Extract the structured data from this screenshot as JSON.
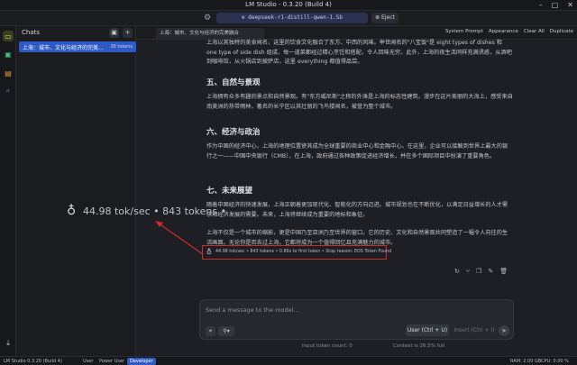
{
  "window": {
    "title": "LM Studio - 0.3.20 (Build 4)",
    "min": "–",
    "max": "□",
    "close": "✕"
  },
  "topbar": {
    "model": "⊕  deepseek-r1-distill-qwen-1.5b",
    "eject": "⊗ Eject"
  },
  "chats": {
    "title": "Chats",
    "items": [
      {
        "title": "上海：城市、文化与经济的完美…",
        "tokens": "36 tokens"
      }
    ]
  },
  "tab": {
    "title": "上海：城市、文化与经济的完美融合"
  },
  "toolbar": {
    "system_prompt": "System Prompt",
    "appearance": "Appearance",
    "clear_all": "Clear All",
    "duplicate": "Duplicate"
  },
  "content": {
    "p1": "上海以其独特的美食闻名，这里的饮食文化融合了东方、中西的风味。举世闻名的\"八宝饭\"是 eight types of dishes 和 one type of side dish 组成，每一道菜都经过精心烹饪和搭配，令人回味无穷。此外，上海的夜生活同样充满诱惑，从酒吧到咖啡馆，从火锅店到披萨店，这里 everything 都值得品尝。",
    "h5": "五、自然与景观",
    "p5": "上海拥有众多有趣的景点和自然景观。有\"东方威尼斯\"之称的外滩是上海的标志性建筑，漫步在这片美丽的大海上，感受来自南美洲的热带雨林。著名的长宁区以其壮丽的飞鸟楼闻名，被誉为整个城市。",
    "h6": "六、经济与政治",
    "p6": "作为中国的经济中心，上海的地理位置使其成为全球重要的商业中心和金融中心。在这里，企业可以接触到世界上最大的银行之一——中国中央银行（CMB），在上海，政府通过各种政策促进经济增长，并在多个国际项目中扮演了重要角色。",
    "h7": "七、未来展望",
    "p7": "随着中国经济的快速发展，上海正朝着更加现代化、智能化的方向迈进。城市规划也在不断优化，以满足日益增长的人才需求和经济发展的需要。未来，上海将继续成为重要的地标和象征。",
    "p8": "上海不仅是一个城市的缩影，更是中国乃至亚洲乃至世界的窗口。它的历史、文化和自然景观共同塑造了一幅令人向往的生活画面。无论你是否去过上海，它都将成为一个值得回忆且充满魅力的城市。"
  },
  "stats": {
    "full": "44.98 tok/sec • 843 tokens • 0.86s to first token • Stop reason: EOS Token Found",
    "zoomed": "44.98 tok/sec • 843 tokens •"
  },
  "composer": {
    "placeholder": "Send a message to the model...",
    "user_btn": "User (Ctrl + U)",
    "insert_btn": "Insert (Ctrl + I)",
    "input_tokens": "Input token count: 0",
    "context": "Context is 26.5% full"
  },
  "status": {
    "app": "LM Studio 0.3.20 (Build 4)",
    "user": "User",
    "power_user": "Power User",
    "developer": "Developer",
    "ram": "RAM: 2.00 GB",
    "cpu": "CPU: 0.00 %"
  }
}
